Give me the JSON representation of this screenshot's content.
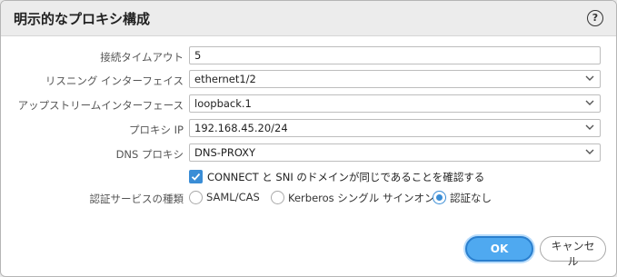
{
  "dialog": {
    "title": "明示的なプロキシ構成",
    "help": "?"
  },
  "form": {
    "connect_timeout": {
      "label": "接続タイムアウト",
      "value": "5"
    },
    "listening_interface": {
      "label": "リスニング インターフェイス",
      "value": "ethernet1/2"
    },
    "upstream_interface": {
      "label": "アップストリームインターフェース",
      "value": "loopback.1"
    },
    "proxy_ip": {
      "label": "プロキシ IP",
      "value": "192.168.45.20/24"
    },
    "dns_proxy": {
      "label": "DNS プロキシ",
      "value": "DNS-PROXY"
    },
    "verify_checkbox": {
      "label": "CONNECT と SNI のドメインが同じであることを確認する",
      "checked": true
    },
    "auth": {
      "label": "認証サービスの種類",
      "options": [
        "SAML/CAS",
        "Kerberos シングル サインオン",
        "認証なし"
      ],
      "selected": "認証なし"
    }
  },
  "buttons": {
    "ok": "OK",
    "cancel": "キャンセル"
  },
  "colors": {
    "accent": "#3a8dd6",
    "ok_button": "#4fa9f0"
  }
}
